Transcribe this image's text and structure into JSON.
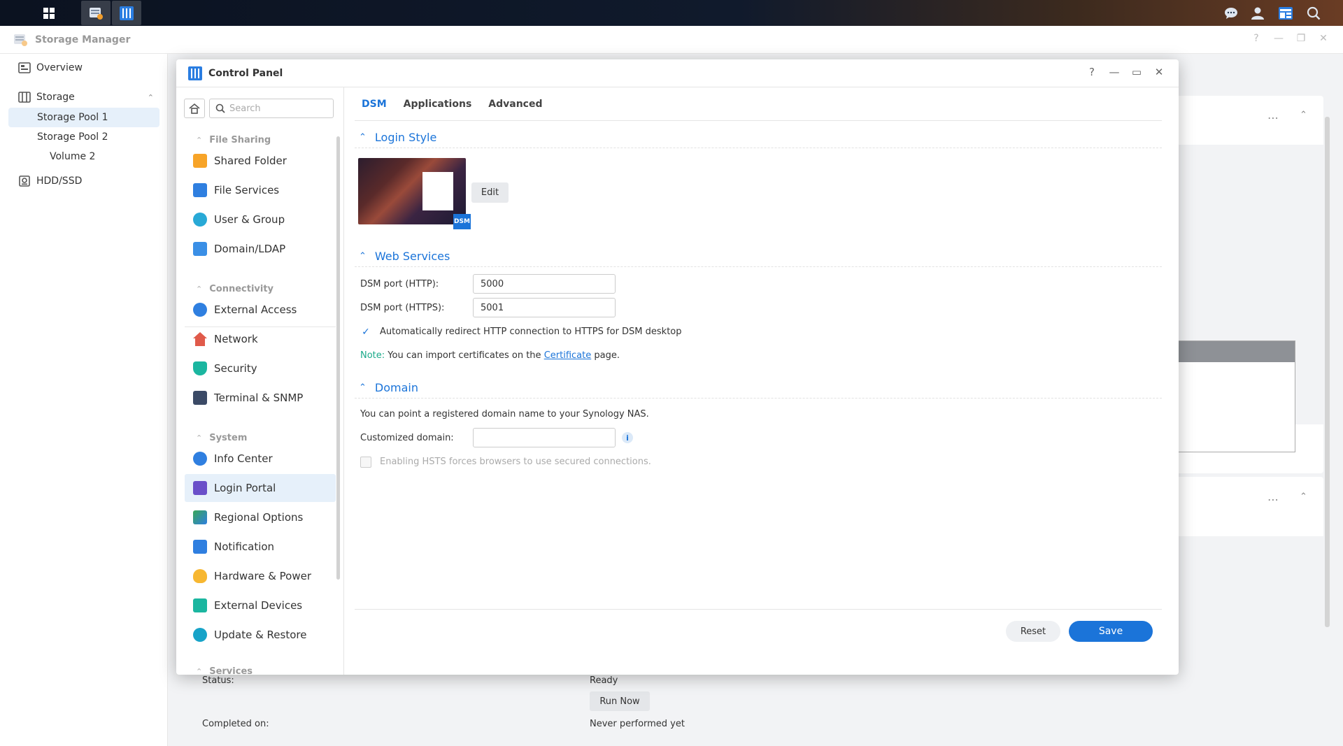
{
  "storage_manager": {
    "title": "Storage Manager",
    "nav": [
      {
        "label": "Overview",
        "icon": "overview-icon"
      },
      {
        "label": "Storage",
        "icon": "storage-icon"
      },
      {
        "label": "Storage Pool 1"
      },
      {
        "label": "Storage Pool 2"
      },
      {
        "label": "Volume 2"
      },
      {
        "label": "HDD/SSD",
        "icon": "disk-icon"
      }
    ],
    "status_label": "Status:",
    "status_value": "Ready",
    "run_now": "Run Now",
    "completed_label": "Completed on:",
    "completed_value": "Never performed yet"
  },
  "control_panel": {
    "title": "Control Panel",
    "search_placeholder": "Search",
    "categories": {
      "file_sharing": "File Sharing",
      "connectivity": "Connectivity",
      "system": "System",
      "services": "Services"
    },
    "items": {
      "shared_folder": "Shared Folder",
      "file_services": "File Services",
      "user_group": "User & Group",
      "domain_ldap": "Domain/LDAP",
      "external_access": "External Access",
      "network": "Network",
      "security": "Security",
      "terminal_snmp": "Terminal & SNMP",
      "info_center": "Info Center",
      "login_portal": "Login Portal",
      "regional_options": "Regional Options",
      "notification": "Notification",
      "hardware_power": "Hardware & Power",
      "external_devices": "External Devices",
      "update_restore": "Update & Restore"
    },
    "tabs": [
      "DSM",
      "Applications",
      "Advanced"
    ],
    "active_tab": "DSM",
    "login_style": {
      "heading": "Login Style",
      "edit": "Edit",
      "badge": "DSM"
    },
    "web_services": {
      "heading": "Web Services",
      "http_label": "DSM port (HTTP):",
      "http_value": "5000",
      "https_label": "DSM port (HTTPS):",
      "https_value": "5001",
      "redirect_label": "Automatically redirect HTTP connection to HTTPS for DSM desktop",
      "redirect_checked": true,
      "note_prefix": "Note:",
      "note_text": "You can import certificates on the",
      "note_link": "Certificate",
      "note_suffix": "page."
    },
    "domain": {
      "heading": "Domain",
      "desc": "You can point a registered domain name to your Synology NAS.",
      "custom_label": "Customized domain:",
      "custom_value": "",
      "hsts_label": "Enabling HSTS forces browsers to use secured connections.",
      "hsts_checked": false
    },
    "buttons": {
      "reset": "Reset",
      "save": "Save"
    }
  },
  "colors": {
    "accent": "#1b74d9",
    "selected_bg": "#e6f0fa"
  }
}
